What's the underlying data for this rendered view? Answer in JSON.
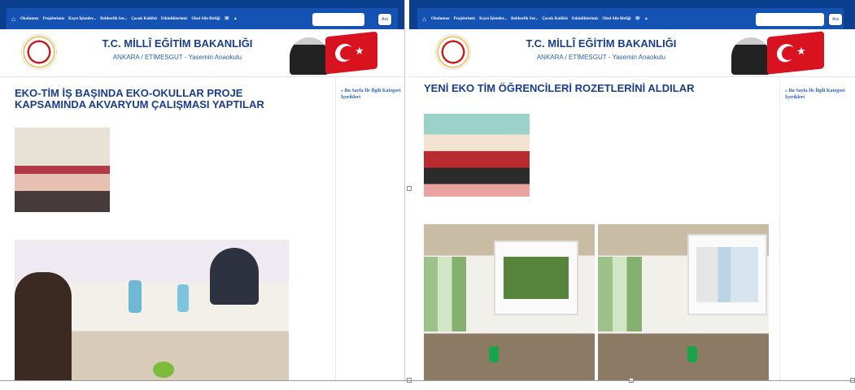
{
  "left_panel": {
    "nav": {
      "items": [
        "Okulumuz",
        "Projelerimiz",
        "Kayıt İşlemler...",
        "Rehberlik Ser...",
        "Çocuk Kulübü",
        "Etkinliklerimiz",
        "Okul Aile Birliği"
      ],
      "search_placeholder": "",
      "search_button": "Ara"
    },
    "header": {
      "title": "T.C. MİLLÎ EĞİTİM BAKANLIĞI",
      "subtitle": "ANKARA / ETİMESGUT - Yasemin Anaokulu"
    },
    "article": {
      "title": "EKO-TİM İŞ BAŞINDA EKO-OKULLAR PROJE KAPSAMINDA AKVARYUM ÇALIŞMASI YAPTILAR"
    },
    "sidebar": {
      "link": "» Bu Sayfa İle İlgili Kategori İçerikleri"
    }
  },
  "right_panel": {
    "nav": {
      "items": [
        "Okulumuz",
        "Projelerimiz",
        "Kayıt İşlemler...",
        "Rehberlik Ser...",
        "Çocuk Kulübü",
        "Etkinliklerimiz",
        "Okul Aile Birliği"
      ],
      "search_placeholder": "",
      "search_button": "Ara"
    },
    "header": {
      "title": "T.C. MİLLÎ EĞİTİM BAKANLIĞI",
      "subtitle": "ANKARA / ETİMESGUT - Yasemin Anaokulu"
    },
    "article": {
      "title": "YENİ EKO TİM ÖĞRENCİLERİ ROZETLERİNİ ALDILAR"
    },
    "sidebar": {
      "link": "» Bu Sayfa İle İlgili Kategori İçerikleri"
    }
  },
  "icons": {
    "home": "home-icon",
    "phone": "phone-icon",
    "person": "person-icon"
  },
  "colors": {
    "nav_bg": "#0d3f8f",
    "nav_bar": "#1452b4",
    "title_blue": "#1a3d8a",
    "flag_red": "#d8121f"
  }
}
